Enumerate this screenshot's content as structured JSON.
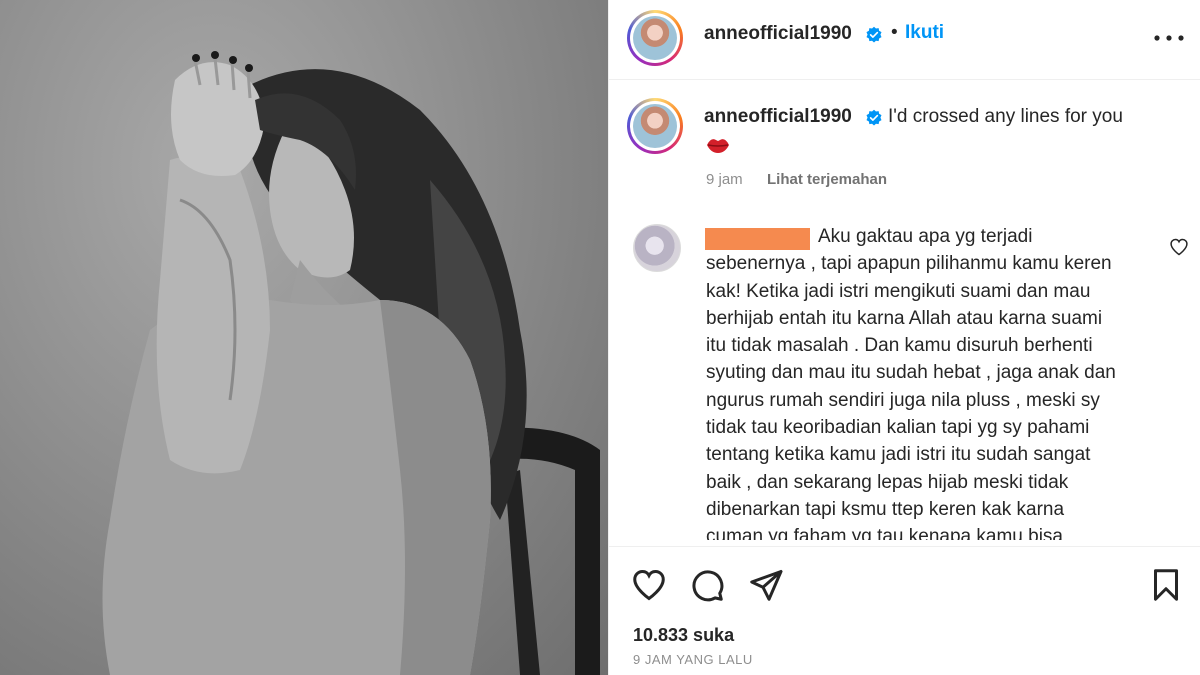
{
  "post": {
    "photo_alt": "photo",
    "username": "anneofficial1990",
    "separator": "•",
    "follow_label": "Ikuti",
    "more_icon": "more-options-icon"
  },
  "caption": {
    "username": "anneofficial1990",
    "text": "I'd crossed any lines for you",
    "emoji": "lips-kiss-icon",
    "time": "9 jam",
    "translate_label": "Lihat terjemahan"
  },
  "comment": {
    "text": "Aku gaktau apa yg terjadi\nsebenernya , tapi apapun pilihanmu kamu keren\nkak! Ketika jadi istri mengikuti suami dan mau\nberhijab entah itu karna Allah atau karna suami\nitu tidak masalah . Dan kamu disuruh berhenti\nsyuting dan mau itu sudah hebat , jaga anak dan\nngurus rumah sendiri juga nila pluss , meski sy\ntidak tau keoribadian kalian tapi yg sy pahami\ntentang ketika kamu jadi istri itu sudah sangat\nbaik , dan sekarang lepas hijab meski tidak\ndibenarkan tapi ksmu ttep keren kak karna\ncuman yg faham yg tau kenapa kamu bisa"
  },
  "actions": {
    "likes": "10.833 suka",
    "time_ago": "9 JAM YANG LALU"
  },
  "colors": {
    "accent": "#0095f6",
    "verified": "#0095f6",
    "redaction": "#f58a4f"
  }
}
